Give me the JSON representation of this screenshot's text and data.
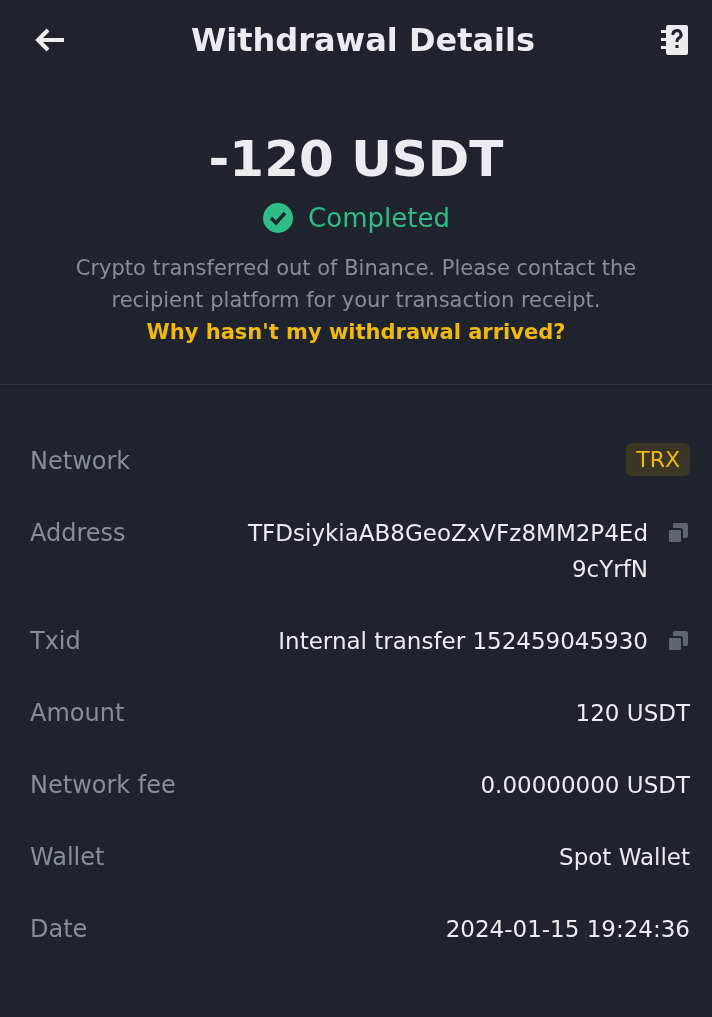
{
  "header": {
    "title": "Withdrawal Details"
  },
  "summary": {
    "amount": "-120 USDT",
    "status": "Completed",
    "completed": true,
    "description": "Crypto transferred out of Binance. Please contact the recipient platform for your transaction receipt.",
    "link": "Why hasn't my withdrawal arrived?"
  },
  "details": [
    {
      "kind": "tag",
      "label": "Network",
      "value": "TRX"
    },
    {
      "kind": "copy",
      "label": "Address",
      "value": "TFDsiykiaAB8GeoZxVFz8MM2P4Ed9cYrfN"
    },
    {
      "kind": "copy",
      "label": "Txid",
      "value": "Internal transfer 152459045930"
    },
    {
      "kind": "plain",
      "label": "Amount",
      "value": "120 USDT"
    },
    {
      "kind": "plain",
      "label": "Network fee",
      "value": "0.00000000 USDT"
    },
    {
      "kind": "plain",
      "label": "Wallet",
      "value": "Spot Wallet"
    },
    {
      "kind": "plain",
      "label": "Date",
      "value": "2024-01-15 19:24:36"
    }
  ]
}
